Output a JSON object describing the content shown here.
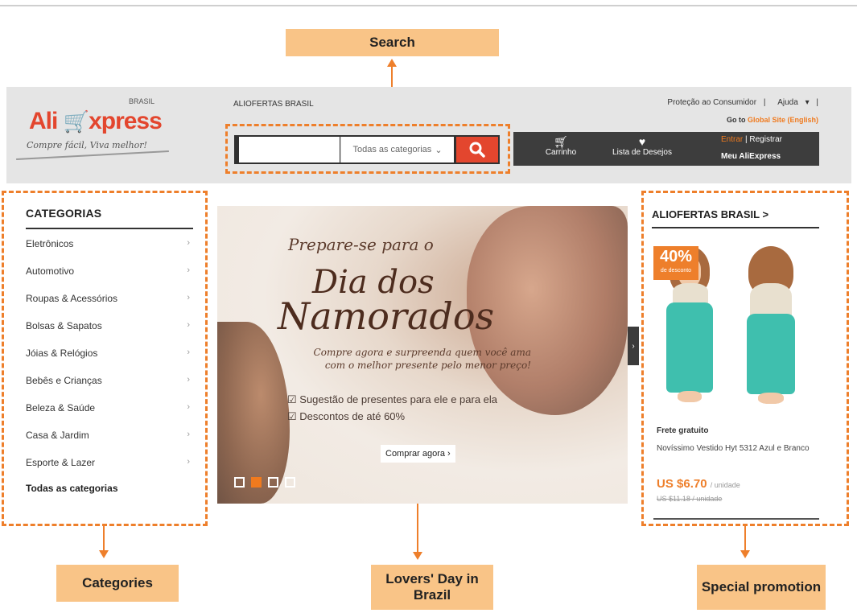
{
  "callouts": {
    "search": "Search",
    "categories": "Categories",
    "lovers_day": "Lovers' Day in Brazil",
    "special_promotion": "Special promotion"
  },
  "header": {
    "logo_text": "Ali",
    "logo_text2": "xpress",
    "logo_country": "BRASIL",
    "slogan": "Compre fácil, Viva melhor!",
    "offers_link": "ALIOFERTAS BRASIL",
    "protection": "Proteção ao Consumidor",
    "help": "Ajuda",
    "global_prefix": "Go to",
    "global_link": "Global Site (English)",
    "search_placeholder": "",
    "category_select": "Todas as categorias",
    "cart": "Carrinho",
    "wishlist": "Lista de Desejos",
    "login": "Entrar",
    "register": "Registrar",
    "my_account": "Meu AliExpress"
  },
  "categories": {
    "title": "CATEGORIAS",
    "items": [
      "Eletrônicos",
      "Automotivo",
      "Roupas & Acessórios",
      "Bolsas & Sapatos",
      "Jóias & Relógios",
      "Bebês e Crianças",
      "Beleza & Saúde",
      "Casa & Jardim",
      "Esporte & Lazer"
    ],
    "all": "Todas as categorias"
  },
  "banner": {
    "prepare": "Prepare-se para o",
    "dia": "Dia dos",
    "namorados": "Namorados",
    "subtitle_1": "Compre agora e surpreenda quem você ama",
    "subtitle_2": "com o melhor presente pelo menor preço!",
    "check_1": "Sugestão de presentes para ele e para ela",
    "check_2": "Descontos de até 60%",
    "button": "Comprar agora ›",
    "active_slide": 2,
    "slide_count": 4
  },
  "promo": {
    "title": "ALIOFERTAS BRASIL >",
    "badge_pct": "40%",
    "badge_label": "de desconto",
    "shipping": "Frete gratuito",
    "name": "Novíssimo Vestido Hyt 5312 Azul e Branco",
    "price": "US $6.70",
    "unit": "/ unidade",
    "old_price": "US $11.18 / unidade"
  },
  "colors": {
    "accent": "#ee7f2b",
    "brand_red": "#e3462e",
    "callout_bg": "#f9c487"
  }
}
